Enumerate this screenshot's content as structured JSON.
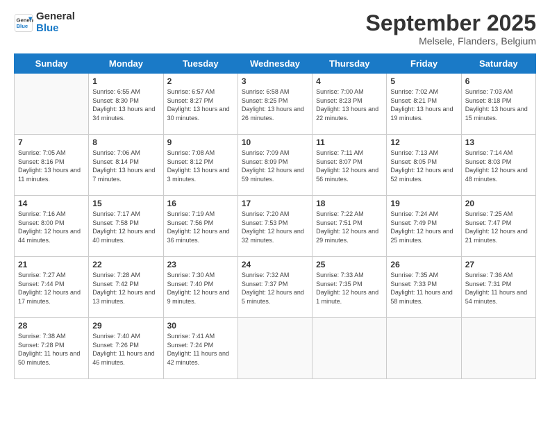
{
  "logo": {
    "line1": "General",
    "line2": "Blue"
  },
  "title": "September 2025",
  "location": "Melsele, Flanders, Belgium",
  "days_of_week": [
    "Sunday",
    "Monday",
    "Tuesday",
    "Wednesday",
    "Thursday",
    "Friday",
    "Saturday"
  ],
  "weeks": [
    [
      {
        "day": null,
        "sunrise": null,
        "sunset": null,
        "daylight": null
      },
      {
        "day": "1",
        "sunrise": "Sunrise: 6:55 AM",
        "sunset": "Sunset: 8:30 PM",
        "daylight": "Daylight: 13 hours and 34 minutes."
      },
      {
        "day": "2",
        "sunrise": "Sunrise: 6:57 AM",
        "sunset": "Sunset: 8:27 PM",
        "daylight": "Daylight: 13 hours and 30 minutes."
      },
      {
        "day": "3",
        "sunrise": "Sunrise: 6:58 AM",
        "sunset": "Sunset: 8:25 PM",
        "daylight": "Daylight: 13 hours and 26 minutes."
      },
      {
        "day": "4",
        "sunrise": "Sunrise: 7:00 AM",
        "sunset": "Sunset: 8:23 PM",
        "daylight": "Daylight: 13 hours and 22 minutes."
      },
      {
        "day": "5",
        "sunrise": "Sunrise: 7:02 AM",
        "sunset": "Sunset: 8:21 PM",
        "daylight": "Daylight: 13 hours and 19 minutes."
      },
      {
        "day": "6",
        "sunrise": "Sunrise: 7:03 AM",
        "sunset": "Sunset: 8:18 PM",
        "daylight": "Daylight: 13 hours and 15 minutes."
      }
    ],
    [
      {
        "day": "7",
        "sunrise": "Sunrise: 7:05 AM",
        "sunset": "Sunset: 8:16 PM",
        "daylight": "Daylight: 13 hours and 11 minutes."
      },
      {
        "day": "8",
        "sunrise": "Sunrise: 7:06 AM",
        "sunset": "Sunset: 8:14 PM",
        "daylight": "Daylight: 13 hours and 7 minutes."
      },
      {
        "day": "9",
        "sunrise": "Sunrise: 7:08 AM",
        "sunset": "Sunset: 8:12 PM",
        "daylight": "Daylight: 13 hours and 3 minutes."
      },
      {
        "day": "10",
        "sunrise": "Sunrise: 7:09 AM",
        "sunset": "Sunset: 8:09 PM",
        "daylight": "Daylight: 12 hours and 59 minutes."
      },
      {
        "day": "11",
        "sunrise": "Sunrise: 7:11 AM",
        "sunset": "Sunset: 8:07 PM",
        "daylight": "Daylight: 12 hours and 56 minutes."
      },
      {
        "day": "12",
        "sunrise": "Sunrise: 7:13 AM",
        "sunset": "Sunset: 8:05 PM",
        "daylight": "Daylight: 12 hours and 52 minutes."
      },
      {
        "day": "13",
        "sunrise": "Sunrise: 7:14 AM",
        "sunset": "Sunset: 8:03 PM",
        "daylight": "Daylight: 12 hours and 48 minutes."
      }
    ],
    [
      {
        "day": "14",
        "sunrise": "Sunrise: 7:16 AM",
        "sunset": "Sunset: 8:00 PM",
        "daylight": "Daylight: 12 hours and 44 minutes."
      },
      {
        "day": "15",
        "sunrise": "Sunrise: 7:17 AM",
        "sunset": "Sunset: 7:58 PM",
        "daylight": "Daylight: 12 hours and 40 minutes."
      },
      {
        "day": "16",
        "sunrise": "Sunrise: 7:19 AM",
        "sunset": "Sunset: 7:56 PM",
        "daylight": "Daylight: 12 hours and 36 minutes."
      },
      {
        "day": "17",
        "sunrise": "Sunrise: 7:20 AM",
        "sunset": "Sunset: 7:53 PM",
        "daylight": "Daylight: 12 hours and 32 minutes."
      },
      {
        "day": "18",
        "sunrise": "Sunrise: 7:22 AM",
        "sunset": "Sunset: 7:51 PM",
        "daylight": "Daylight: 12 hours and 29 minutes."
      },
      {
        "day": "19",
        "sunrise": "Sunrise: 7:24 AM",
        "sunset": "Sunset: 7:49 PM",
        "daylight": "Daylight: 12 hours and 25 minutes."
      },
      {
        "day": "20",
        "sunrise": "Sunrise: 7:25 AM",
        "sunset": "Sunset: 7:47 PM",
        "daylight": "Daylight: 12 hours and 21 minutes."
      }
    ],
    [
      {
        "day": "21",
        "sunrise": "Sunrise: 7:27 AM",
        "sunset": "Sunset: 7:44 PM",
        "daylight": "Daylight: 12 hours and 17 minutes."
      },
      {
        "day": "22",
        "sunrise": "Sunrise: 7:28 AM",
        "sunset": "Sunset: 7:42 PM",
        "daylight": "Daylight: 12 hours and 13 minutes."
      },
      {
        "day": "23",
        "sunrise": "Sunrise: 7:30 AM",
        "sunset": "Sunset: 7:40 PM",
        "daylight": "Daylight: 12 hours and 9 minutes."
      },
      {
        "day": "24",
        "sunrise": "Sunrise: 7:32 AM",
        "sunset": "Sunset: 7:37 PM",
        "daylight": "Daylight: 12 hours and 5 minutes."
      },
      {
        "day": "25",
        "sunrise": "Sunrise: 7:33 AM",
        "sunset": "Sunset: 7:35 PM",
        "daylight": "Daylight: 12 hours and 1 minute."
      },
      {
        "day": "26",
        "sunrise": "Sunrise: 7:35 AM",
        "sunset": "Sunset: 7:33 PM",
        "daylight": "Daylight: 11 hours and 58 minutes."
      },
      {
        "day": "27",
        "sunrise": "Sunrise: 7:36 AM",
        "sunset": "Sunset: 7:31 PM",
        "daylight": "Daylight: 11 hours and 54 minutes."
      }
    ],
    [
      {
        "day": "28",
        "sunrise": "Sunrise: 7:38 AM",
        "sunset": "Sunset: 7:28 PM",
        "daylight": "Daylight: 11 hours and 50 minutes."
      },
      {
        "day": "29",
        "sunrise": "Sunrise: 7:40 AM",
        "sunset": "Sunset: 7:26 PM",
        "daylight": "Daylight: 11 hours and 46 minutes."
      },
      {
        "day": "30",
        "sunrise": "Sunrise: 7:41 AM",
        "sunset": "Sunset: 7:24 PM",
        "daylight": "Daylight: 11 hours and 42 minutes."
      },
      {
        "day": null,
        "sunrise": null,
        "sunset": null,
        "daylight": null
      },
      {
        "day": null,
        "sunrise": null,
        "sunset": null,
        "daylight": null
      },
      {
        "day": null,
        "sunrise": null,
        "sunset": null,
        "daylight": null
      },
      {
        "day": null,
        "sunrise": null,
        "sunset": null,
        "daylight": null
      }
    ]
  ]
}
